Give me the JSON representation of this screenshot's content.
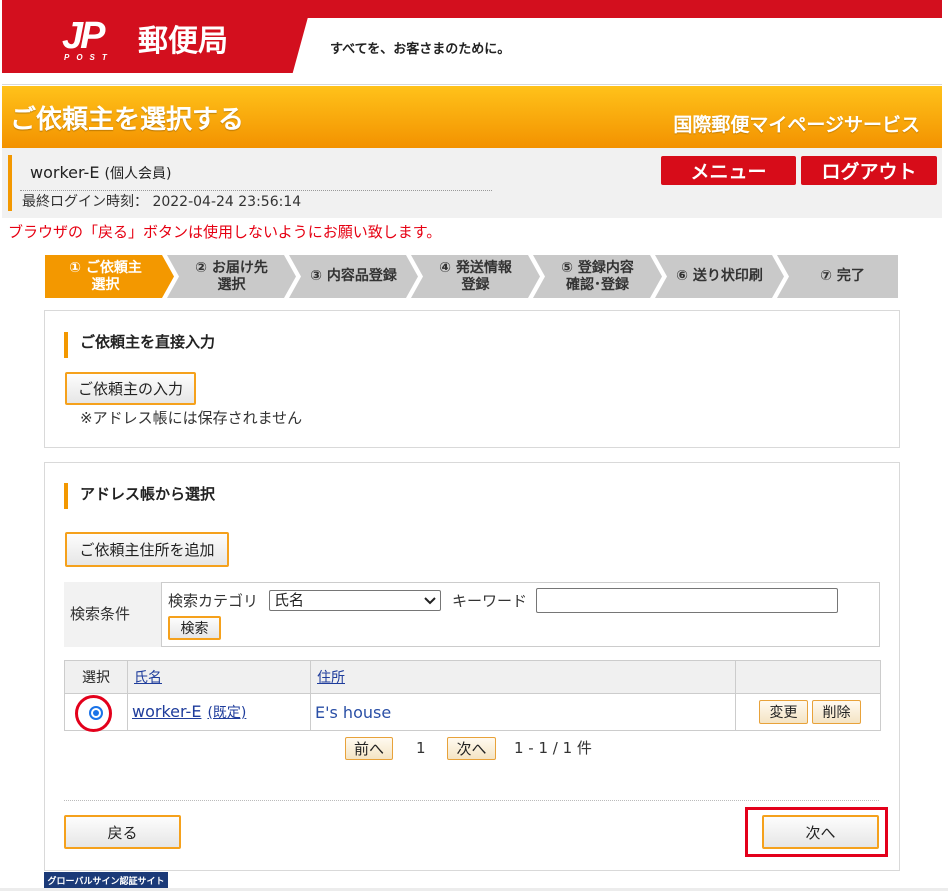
{
  "header": {
    "logo_mark": "JP",
    "logo_sub": "POST",
    "logo_name": "郵便局",
    "tagline": "すべてを、お客さまのために。"
  },
  "banner": {
    "title": "ご依頼主を選択する",
    "service_name": "国際郵便マイページサービス"
  },
  "user": {
    "name": "worker-E",
    "member_type": "(個人会員)",
    "last_login_label": "最終ログイン時刻：",
    "last_login_value": "2022-04-24 23:56:14"
  },
  "nav": {
    "menu_label": "メニュー",
    "logout_label": "ログアウト"
  },
  "warning": "ブラウザの「戻る」ボタンは使用しないようにお願い致します。",
  "current_step": 1,
  "steps": [
    {
      "number": "①",
      "line1": "ご依頼主",
      "line2": "選択"
    },
    {
      "number": "②",
      "line1": "お届け先",
      "line2": "選択"
    },
    {
      "number": "③",
      "line1": "内容品登録",
      "line2": ""
    },
    {
      "number": "④",
      "line1": "発送情報",
      "line2": "登録"
    },
    {
      "number": "⑤",
      "line1": "登録内容",
      "line2": "確認･登録"
    },
    {
      "number": "⑥",
      "line1": "送り状印刷",
      "line2": ""
    },
    {
      "number": "⑦",
      "line1": "完了",
      "line2": ""
    }
  ],
  "direct_input": {
    "heading": "ご依頼主を直接入力",
    "button_label": "ご依頼主の入力",
    "note": "※アドレス帳には保存されません"
  },
  "address_book": {
    "heading": "アドレス帳から選択",
    "add_button_label": "ご依頼主住所を追加",
    "search": {
      "label": "検索条件",
      "category_label": "検索カテゴリ",
      "category_value": "氏名",
      "keyword_label": "キーワード",
      "keyword_value": "",
      "button_label": "検索"
    },
    "table": {
      "headers": {
        "select": "選択",
        "name": "氏名",
        "address": "住所"
      },
      "rows": [
        {
          "selected": true,
          "name": "worker-E",
          "default_tag": "(既定)",
          "address": "E's house",
          "edit_label": "変更",
          "delete_label": "削除"
        }
      ]
    },
    "pagination": {
      "prev_label": "前へ",
      "current_page": "1",
      "next_label": "次へ",
      "summary": "1 - 1 / 1 件"
    }
  },
  "footer_nav": {
    "back_label": "戻る",
    "next_label": "次へ"
  },
  "badge": "グローバルサイン認証サイト",
  "colors": {
    "brand_red": "#d30f1e",
    "accent_orange": "#f39800",
    "highlight_red": "#e3001b",
    "link_blue": "#1f3d9c"
  },
  "icons": {
    "radio": "radio-selected-icon",
    "select_arrow": "chevron-down-icon"
  }
}
